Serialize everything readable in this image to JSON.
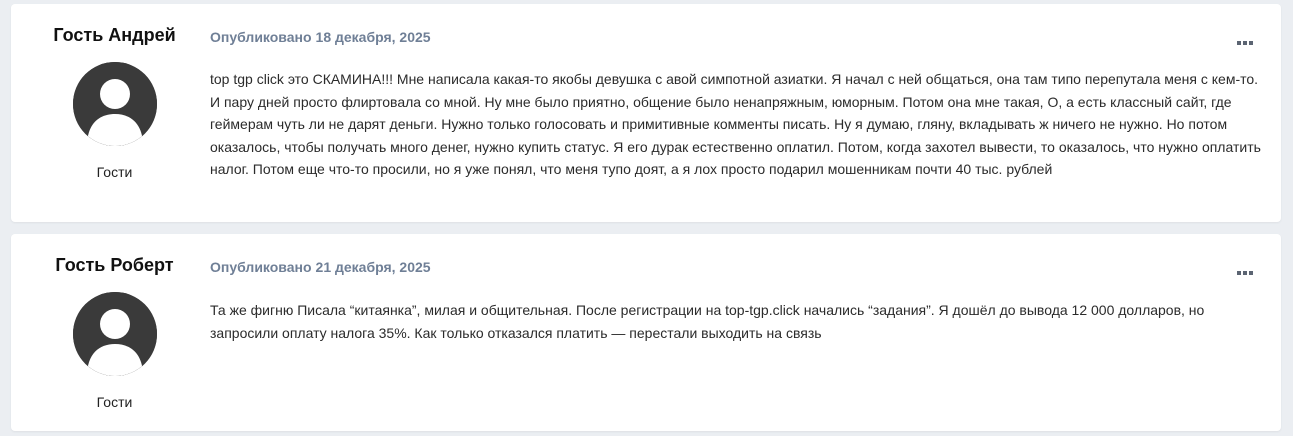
{
  "published_label": "Опубликовано",
  "posts": [
    {
      "author": "Гость Андрей",
      "group": "Гости",
      "date": "18 декабря, 2025",
      "content": "top tgp click это СКАМИНА!!! Мне написала какая-то якобы девушка с авой симпотной азиатки. Я начал с ней общаться, она там типо перепутала меня с кем-то. И пару дней просто флиртовала со мной. Ну мне было приятно, общение было ненапряжным, юморным. Потом она мне такая, О, а есть классный сайт, где геймерам чуть ли не дарят деньги. Нужно только голосовать и примитивные комменты писать. Ну я думаю, гляну, вкладывать ж ничего не нужно. Но потом оказалось, чтобы получать много денег, нужно купить статус. Я его дурак естественно оплатил. Потом, когда захотел вывести, то оказалось, что нужно оплатить налог. Потом еще что-то просили, но я уже понял, что меня тупо доят, а я лох просто подарил мошенникам почти 40 тыс. рублей"
    },
    {
      "author": "Гость Роберт",
      "group": "Гости",
      "date": "21 декабря, 2025",
      "content": "Та же фигню Писала “китаянка”, милая и общительная. После регистрации на top-tgp.click начались “задания”. Я дошёл до вывода 12 000 долларов, но запросили оплату налога 35%. Как только отказался платить — перестали выходить на связь"
    }
  ],
  "icons": {
    "avatar": "default-avatar-icon",
    "more": "ellipsis-icon"
  },
  "colors": {
    "background": "#ebeef2",
    "card": "#ffffff",
    "meta": "#6f7f96",
    "avatar": "#3a3a3a"
  }
}
